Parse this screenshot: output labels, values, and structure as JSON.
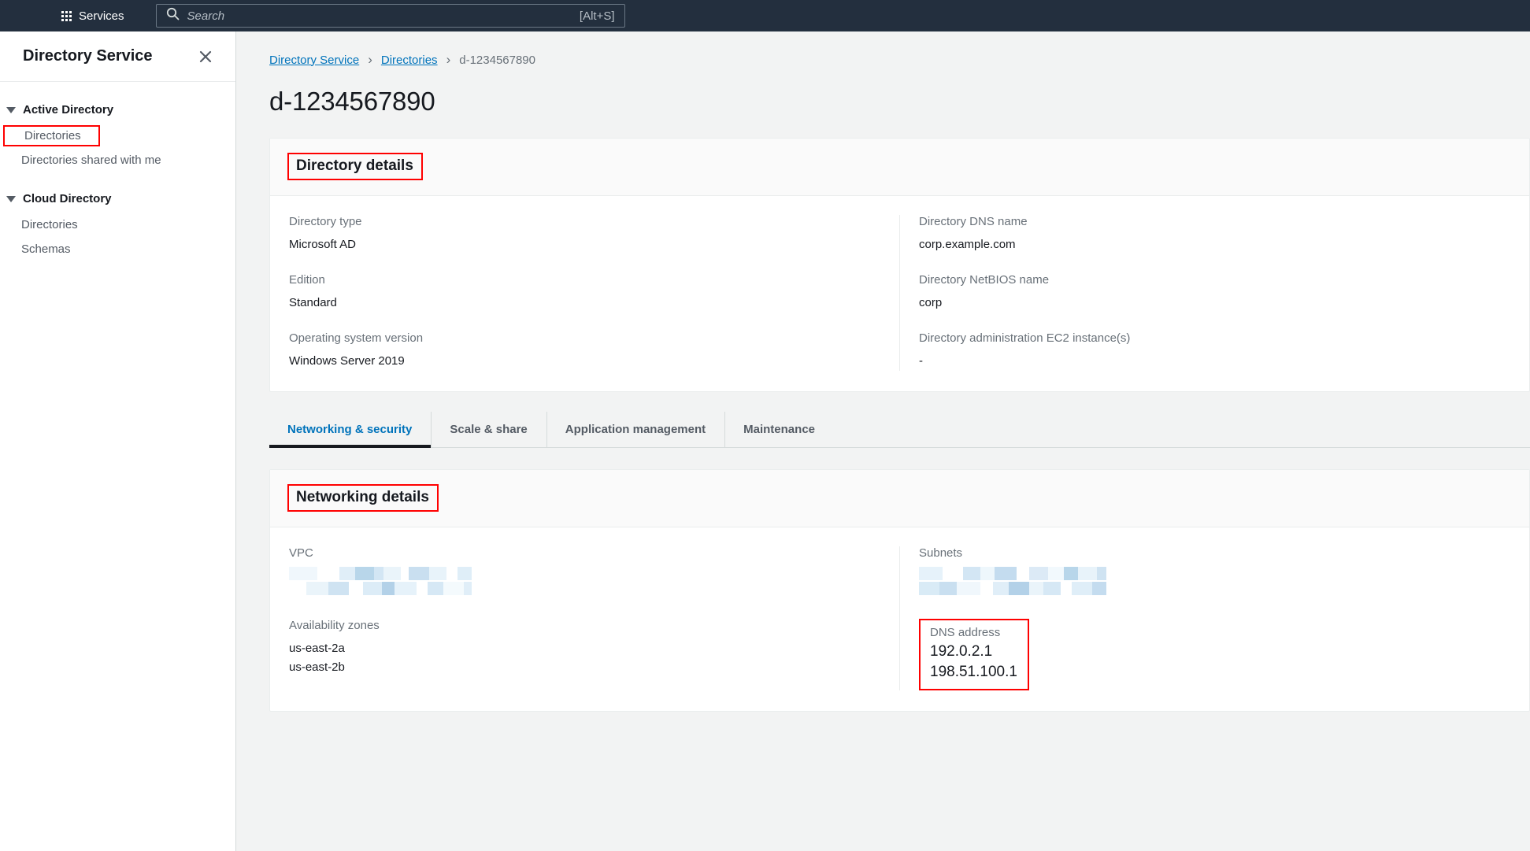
{
  "topnav": {
    "services_label": "Services",
    "services_icon": "grid-apps-icon",
    "search_icon": "search-icon",
    "search_placeholder": "Search",
    "search_value": "",
    "shortcut_hint": "[Alt+S]",
    "background": "#232f3e"
  },
  "sidebar": {
    "title": "Directory Service",
    "close_icon": "close-icon",
    "groups": [
      {
        "label": "Active Directory",
        "items": [
          {
            "label": "Directories",
            "highlighted": true
          },
          {
            "label": "Directories shared with me",
            "highlighted": false
          }
        ]
      },
      {
        "label": "Cloud Directory",
        "items": [
          {
            "label": "Directories",
            "highlighted": false
          },
          {
            "label": "Schemas",
            "highlighted": false
          }
        ]
      }
    ]
  },
  "breadcrumb": {
    "items": [
      {
        "label": "Directory Service",
        "link": true
      },
      {
        "label": "Directories",
        "link": true
      },
      {
        "label": "d-1234567890",
        "link": false
      }
    ],
    "separator": "›"
  },
  "page": {
    "title": "d-1234567890"
  },
  "directory_details": {
    "heading": "Directory details",
    "left": [
      {
        "label": "Directory type",
        "value": "Microsoft AD"
      },
      {
        "label": "Edition",
        "value": "Standard"
      },
      {
        "label": "Operating system version",
        "value": "Windows Server 2019"
      }
    ],
    "right": [
      {
        "label": "Directory DNS name",
        "value": "corp.example.com"
      },
      {
        "label": "Directory NetBIOS name",
        "value": "corp"
      },
      {
        "label": "Directory administration EC2 instance(s)",
        "value": "-"
      }
    ]
  },
  "tabs": [
    {
      "label": "Networking & security",
      "active": true
    },
    {
      "label": "Scale & share",
      "active": false
    },
    {
      "label": "Application management",
      "active": false
    },
    {
      "label": "Maintenance",
      "active": false
    }
  ],
  "networking_details": {
    "heading": "Networking details",
    "vpc": {
      "label": "VPC",
      "value_redacted": true
    },
    "availability_zones": {
      "label": "Availability zones",
      "values": [
        "us-east-2a",
        "us-east-2b"
      ]
    },
    "subnets": {
      "label": "Subnets",
      "value_redacted": true
    },
    "dns_address": {
      "label": "DNS address",
      "values": [
        "192.0.2.1",
        "198.51.100.1"
      ],
      "highlighted": true
    }
  },
  "colors": {
    "nav_background": "#232f3e",
    "page_background": "#f2f3f3",
    "card_background": "#ffffff",
    "link": "#0073bb",
    "label_text": "#687078",
    "value_text": "#16191f",
    "highlight_box": "#ff0000",
    "active_tab_underline": "#16191f",
    "redaction": "#b3d1e8"
  }
}
